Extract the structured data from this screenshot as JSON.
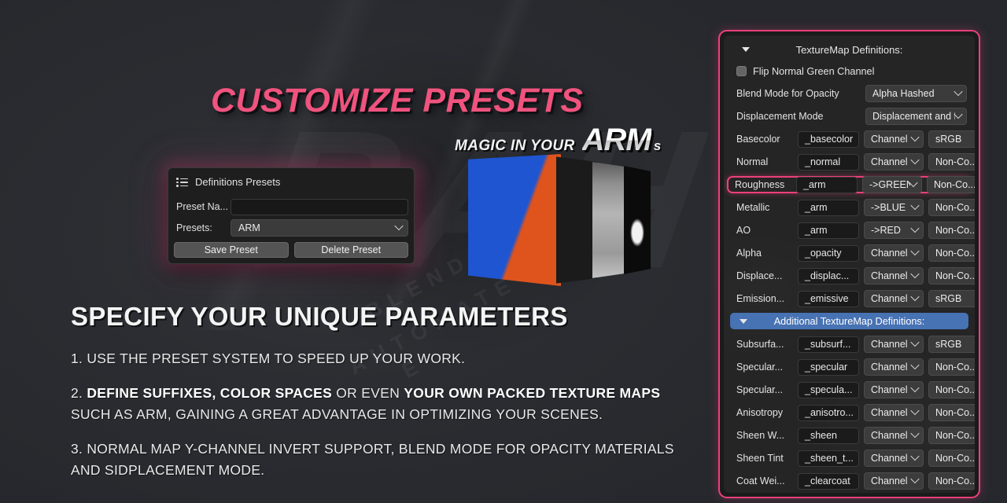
{
  "hero": {
    "title": "CUSTOMIZE PRESETS",
    "subtitle_prefix": "MAGIC IN YOUR",
    "subtitle_brand": "ARM",
    "subtitle_suffix": "s"
  },
  "section": {
    "title": "SPECIFY YOUR UNIQUE PARAMETERS",
    "bullets": [
      {
        "parts": [
          {
            "text": "1. USE THE PRESET SYSTEM TO SPEED UP YOUR WORK.",
            "bold": false
          }
        ]
      },
      {
        "parts": [
          {
            "text": "2. ",
            "bold": false
          },
          {
            "text": "DEFINE SUFFIXES, COLOR SPACES",
            "bold": true
          },
          {
            "text": " OR EVEN ",
            "bold": false
          },
          {
            "text": "YOUR OWN PACKED TEXTURE MAPS",
            "bold": true
          },
          {
            "text": " SUCH AS ARM, GAINING A GREAT ADVANTAGE IN OPTIMIZING YOUR SCENES.",
            "bold": false
          }
        ]
      },
      {
        "parts": [
          {
            "text": "3. NORMAL MAP Y-CHANNEL INVERT SUPPORT, BLEND MODE FOR OPACITY MATERIALS AND SIDPLACEMENT MODE.",
            "bold": false
          }
        ]
      }
    ]
  },
  "watermark": {
    "big": "BAH",
    "line1": "BLENDER",
    "line2": "AUTOMATE",
    "line3": "E"
  },
  "presets_dialog": {
    "icon": "list-icon",
    "title": "Definitions Presets",
    "preset_name_label": "Preset Na...",
    "preset_name_value": "",
    "preset_name_placeholder": "",
    "presets_label": "Presets:",
    "presets_value": "ARM",
    "save_label": "Save Preset",
    "delete_label": "Delete Preset"
  },
  "texture_panel": {
    "header": "TextureMap Definitions:",
    "header_triangle": "triangle-down-icon",
    "flip_normal_label": "Flip Normal Green Channel",
    "flip_normal_checked": false,
    "top_rows": [
      {
        "label": "Blend Mode for Opacity",
        "select": "Alpha Hashed"
      },
      {
        "label": "Displacement Mode",
        "select": "Displacement and B..."
      }
    ],
    "map_rows": [
      {
        "label": "Basecolor",
        "suffix": "_basecolor",
        "channel": "Channel",
        "colorspace": "sRGB",
        "highlight": false
      },
      {
        "label": "Normal",
        "suffix": "_normal",
        "channel": "Channel",
        "colorspace": "Non-Co...",
        "highlight": false
      },
      {
        "label": "Roughness",
        "suffix": "_arm",
        "channel": "->GREEN",
        "colorspace": "Non-Co...",
        "highlight": true
      },
      {
        "label": "Metallic",
        "suffix": "_arm",
        "channel": "->BLUE",
        "colorspace": "Non-Co...",
        "highlight": false
      },
      {
        "label": "AO",
        "suffix": "_arm",
        "channel": "->RED",
        "colorspace": "Non-Co...",
        "highlight": false
      },
      {
        "label": "Alpha",
        "suffix": "_opacity",
        "channel": "Channel",
        "colorspace": "Non-Co...",
        "highlight": false
      },
      {
        "label": "Displace...",
        "suffix": "_displac...",
        "channel": "Channel",
        "colorspace": "Non-Co...",
        "highlight": false
      },
      {
        "label": "Emission...",
        "suffix": "_emissive",
        "channel": "Channel",
        "colorspace": "sRGB",
        "highlight": false
      }
    ],
    "additional_header": "Additional TextureMap Definitions:",
    "additional_rows": [
      {
        "label": "Subsurfa...",
        "suffix": "_subsurf...",
        "channel": "Channel",
        "colorspace": "sRGB"
      },
      {
        "label": "Specular...",
        "suffix": "_specular",
        "channel": "Channel",
        "colorspace": "Non-Co..."
      },
      {
        "label": "Specular...",
        "suffix": "_specula...",
        "channel": "Channel",
        "colorspace": "Non-Co..."
      },
      {
        "label": "Anisotropy",
        "suffix": "_anisotro...",
        "channel": "Channel",
        "colorspace": "Non-Co..."
      },
      {
        "label": "Sheen W...",
        "suffix": "_sheen",
        "channel": "Channel",
        "colorspace": "Non-Co..."
      },
      {
        "label": "Sheen Tint",
        "suffix": "_sheen_t...",
        "channel": "Channel",
        "colorspace": "Non-Co..."
      },
      {
        "label": "Coat Wei...",
        "suffix": "_clearcoat",
        "channel": "Channel",
        "colorspace": "Non-Co..."
      }
    ]
  },
  "colors": {
    "accent_pink": "#ec407a",
    "hero_pink": "#f0537e",
    "subheader_blue": "#4772b3",
    "background": "#27292e",
    "panel_bg": "#252525"
  }
}
